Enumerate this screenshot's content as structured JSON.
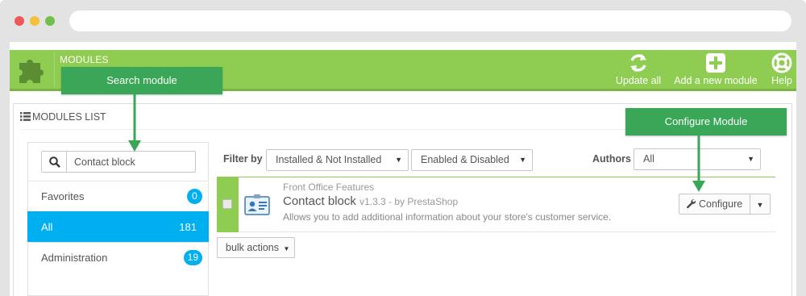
{
  "toolbar": {
    "title": "MODULES",
    "update_all": "Update all",
    "add_module": "Add a new module",
    "help": "Help"
  },
  "callouts": {
    "search": "Search module",
    "configure": "Configure Module"
  },
  "panel": {
    "heading": "MODULES LIST"
  },
  "search": {
    "value": "Contact block"
  },
  "categories": [
    {
      "label": "Favorites",
      "count": "0"
    },
    {
      "label": "All",
      "count": "181"
    },
    {
      "label": "Administration",
      "count": "19"
    }
  ],
  "filters": {
    "filter_by_label": "Filter by",
    "install_value": "Installed & Not Installed",
    "enabled_value": "Enabled & Disabled",
    "authors_label": "Authors",
    "authors_value": "All"
  },
  "module": {
    "category": "Front Office Features",
    "name": "Contact block",
    "version": "v1.3.3 - by PrestaShop",
    "description": "Allows you to add additional information about your store's customer service.",
    "configure_label": "Configure"
  },
  "bulk_actions": "bulk actions",
  "colors": {
    "toolbar_green": "#8fcc52",
    "callout_green": "#3aa657",
    "active_blue": "#00aff0"
  }
}
